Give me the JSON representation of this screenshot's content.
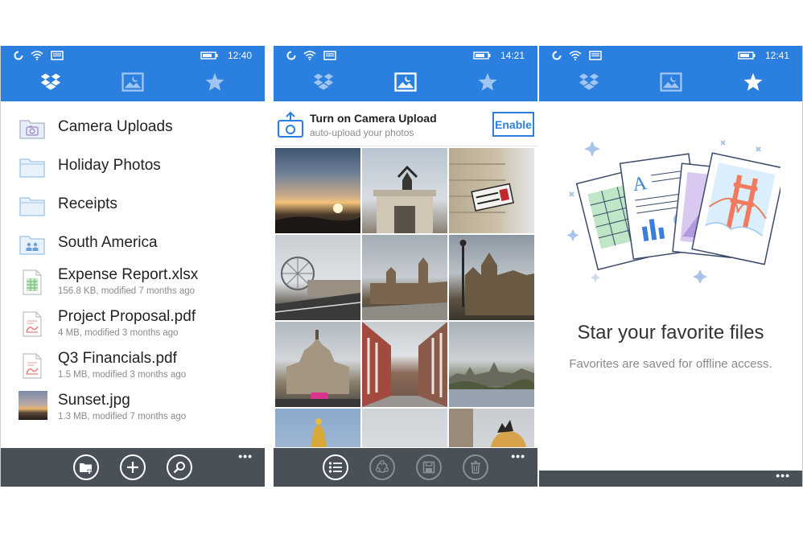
{
  "colors": {
    "accent": "#2b7fde",
    "appbar": "#4a5058",
    "text": "#222222",
    "meta": "#8a8a8a"
  },
  "screens": [
    {
      "status": {
        "time": "12:40"
      },
      "tabs": [
        {
          "icon": "dropbox-icon",
          "active": true
        },
        {
          "icon": "photos-icon",
          "active": false
        },
        {
          "icon": "star-icon",
          "active": false
        }
      ],
      "files": [
        {
          "name": "Camera Uploads",
          "icon": "camera-folder-icon"
        },
        {
          "name": "Holiday Photos",
          "icon": "folder-icon"
        },
        {
          "name": "Receipts",
          "icon": "folder-icon"
        },
        {
          "name": "South America",
          "icon": "shared-folder-icon"
        },
        {
          "name": "Expense Report.xlsx",
          "meta": "156.8 KB, modified 7 months ago",
          "icon": "spreadsheet-icon"
        },
        {
          "name": "Project Proposal.pdf",
          "meta": "4 MB, modified 3 months ago",
          "icon": "pdf-icon"
        },
        {
          "name": "Q3 Financials.pdf",
          "meta": "1.5 MB, modified 3 months ago",
          "icon": "pdf-icon"
        },
        {
          "name": "Sunset.jpg",
          "meta": "1.3 MB, modified 7 months ago",
          "icon": "image-thumbnail"
        }
      ],
      "appbar": {
        "buttons": [
          "new-folder-icon",
          "add-icon",
          "search-icon"
        ],
        "more": "•••"
      }
    },
    {
      "status": {
        "time": "14:21"
      },
      "tabs": [
        {
          "icon": "dropbox-icon",
          "active": false
        },
        {
          "icon": "photos-icon",
          "active": true
        },
        {
          "icon": "star-icon",
          "active": false
        }
      ],
      "camera_upload": {
        "title": "Turn on Camera Upload",
        "subtitle": "auto-upload your photos",
        "button": "Enable"
      },
      "appbar": {
        "buttons": [
          "select-list-icon",
          "share-icon",
          "save-icon",
          "delete-icon"
        ],
        "more": "•••"
      }
    },
    {
      "status": {
        "time": "12:41"
      },
      "tabs": [
        {
          "icon": "dropbox-icon",
          "active": false
        },
        {
          "icon": "photos-icon",
          "active": false
        },
        {
          "icon": "star-icon",
          "active": true
        }
      ],
      "favorites": {
        "title": "Star your favorite files",
        "subtitle": "Favorites are saved for offline access."
      },
      "appbar": {
        "more": "•••"
      }
    }
  ]
}
